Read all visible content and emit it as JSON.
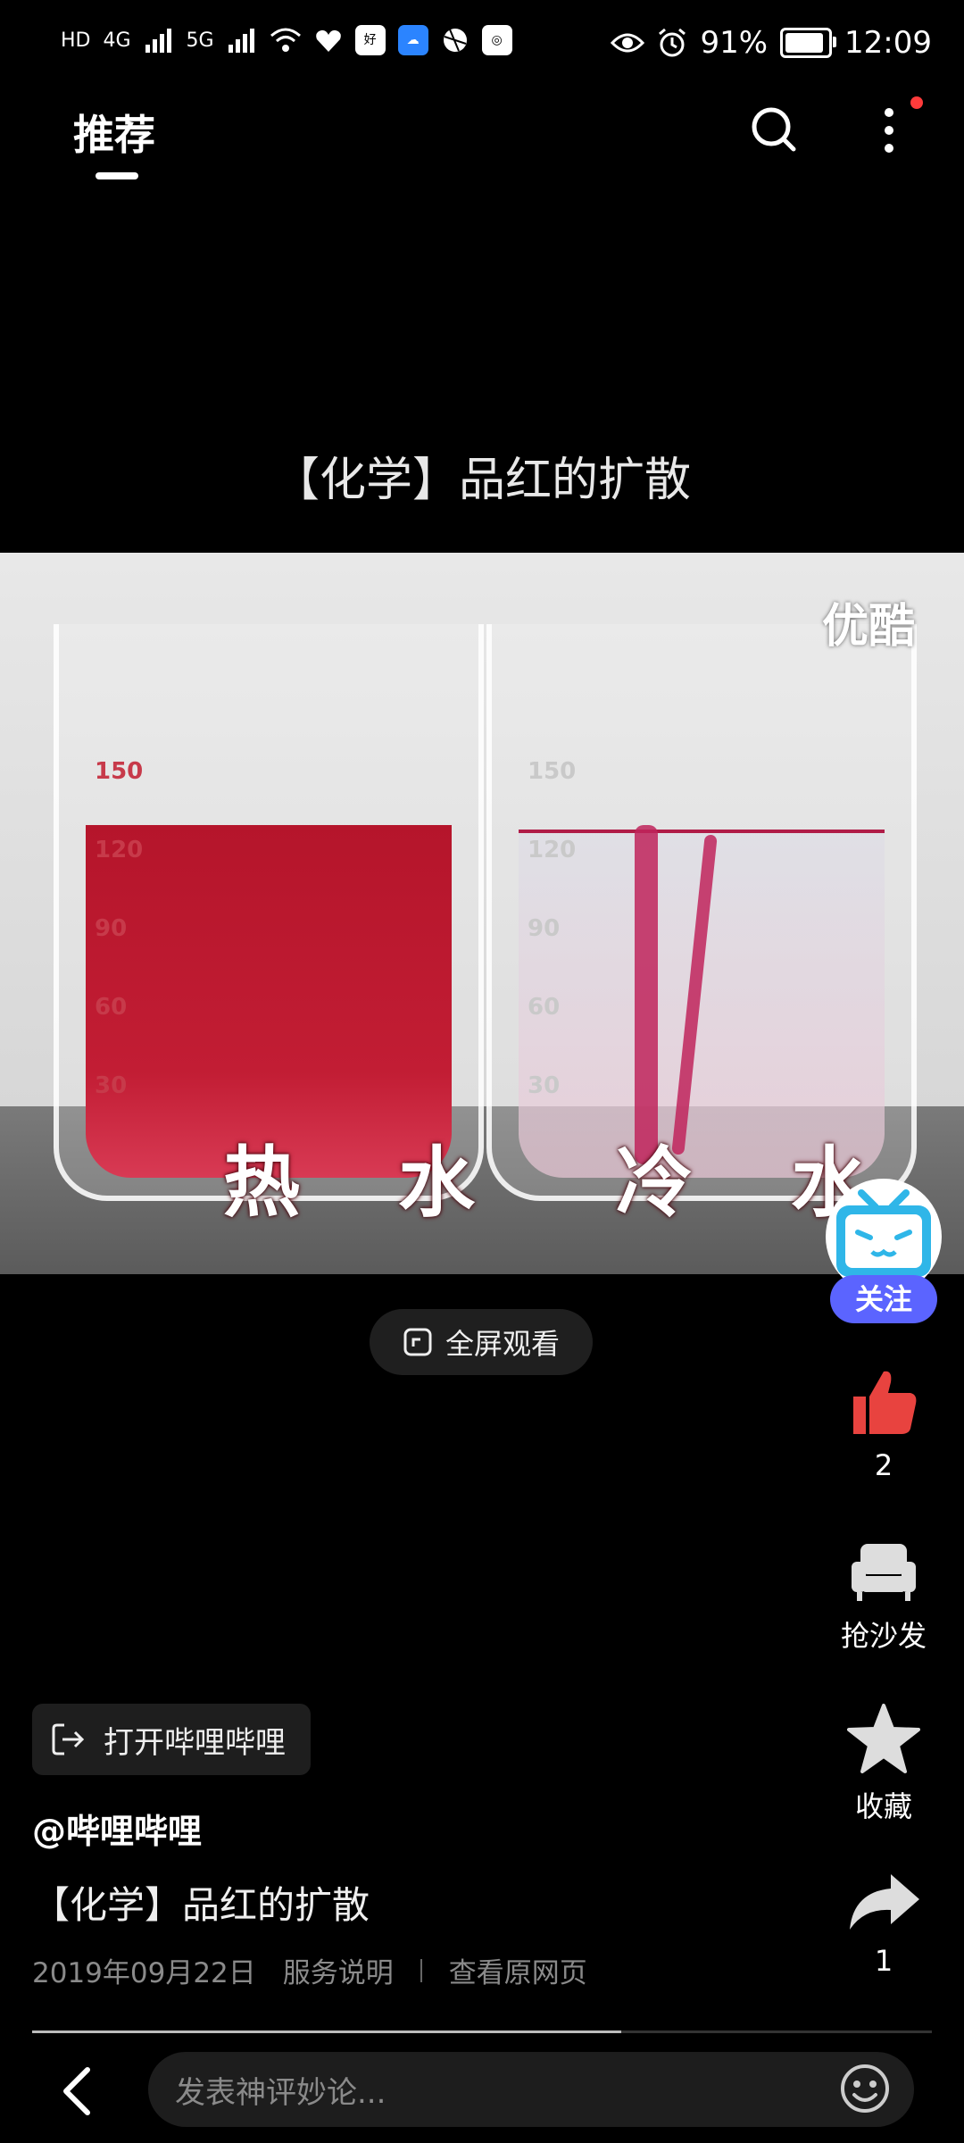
{
  "status_bar": {
    "left_labels": [
      "HD",
      "4G",
      "5G"
    ],
    "chip1": "好",
    "battery_percent": "91%",
    "battery_level": 0.91,
    "time": "12:09"
  },
  "header": {
    "tab_label": "推荐"
  },
  "video": {
    "title": "【化学】品红的扩散",
    "label_left": "热 水",
    "label_right": "冷 水",
    "watermark": "优酷",
    "hot_ticks": [
      "150",
      "120",
      "90",
      "60",
      "30"
    ],
    "cold_ticks": [
      "150",
      "120",
      "90",
      "60",
      "30"
    ],
    "fullscreen_label": "全屏观看"
  },
  "rail": {
    "follow_label": "关注",
    "like_count": "2",
    "sofa_label": "抢沙发",
    "favorite_label": "收藏",
    "share_count": "1"
  },
  "info": {
    "open_app_label": "打开哔哩哔哩",
    "uploader": "@哔哩哔哩",
    "description": "【化学】品红的扩散",
    "date": "2019年09月22日",
    "service_link": "服务说明",
    "original_link": "查看原网页"
  },
  "bottom": {
    "comment_placeholder": "发表神评妙论..."
  },
  "colors": {
    "accent_follow": "#5b64ff",
    "like_red": "#e8433f",
    "notify_dot": "#ff3b3b"
  }
}
